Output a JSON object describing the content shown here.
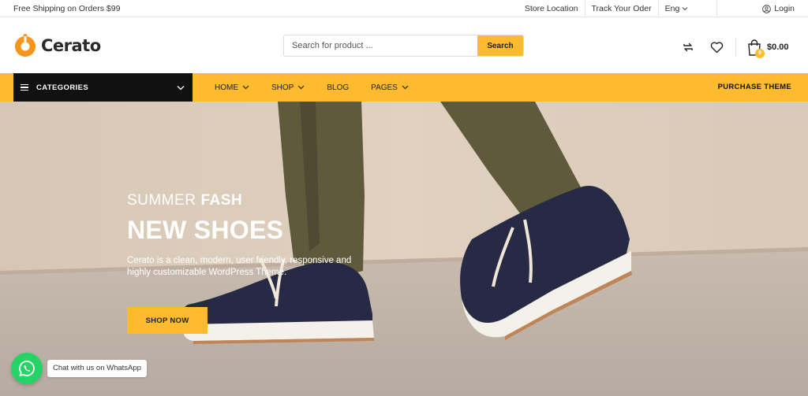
{
  "topbar": {
    "shipping_text": "Free Shipping on Orders $99",
    "store_location": "Store Location",
    "track_order": "Track Your Oder",
    "language": "Eng",
    "login": "Login"
  },
  "header": {
    "logo_text": "Cerato",
    "search_placeholder": "Search for product ...",
    "search_button": "Search",
    "cart_badge": "0",
    "cart_total": "$0.00"
  },
  "nav": {
    "categories_label": "CATEGORIES",
    "items": [
      {
        "label": "HOME"
      },
      {
        "label": "SHOP"
      },
      {
        "label": "BLOG"
      },
      {
        "label": "PAGES"
      }
    ],
    "purchase_label": "PURCHASE THEME"
  },
  "hero": {
    "subtitle_light": "SUMMER",
    "subtitle_bold": "FASH",
    "title": "NEW SHOES",
    "description": "Cerato is a clean, modern, user friendly, responsive and highly customizable WordPress Theme.",
    "button_label": "SHOP NOW"
  },
  "whatsapp": {
    "label": "Chat with us on WhatsApp"
  },
  "colors": {
    "accent": "#fdbb2d",
    "logo_orange": "#f7941d",
    "category_bg": "#111111",
    "whatsapp_green": "#25d366"
  },
  "icons": [
    "user-icon",
    "compare-icon",
    "heart-icon",
    "cart-icon",
    "menu-icon",
    "chevron-down-icon",
    "whatsapp-icon"
  ]
}
